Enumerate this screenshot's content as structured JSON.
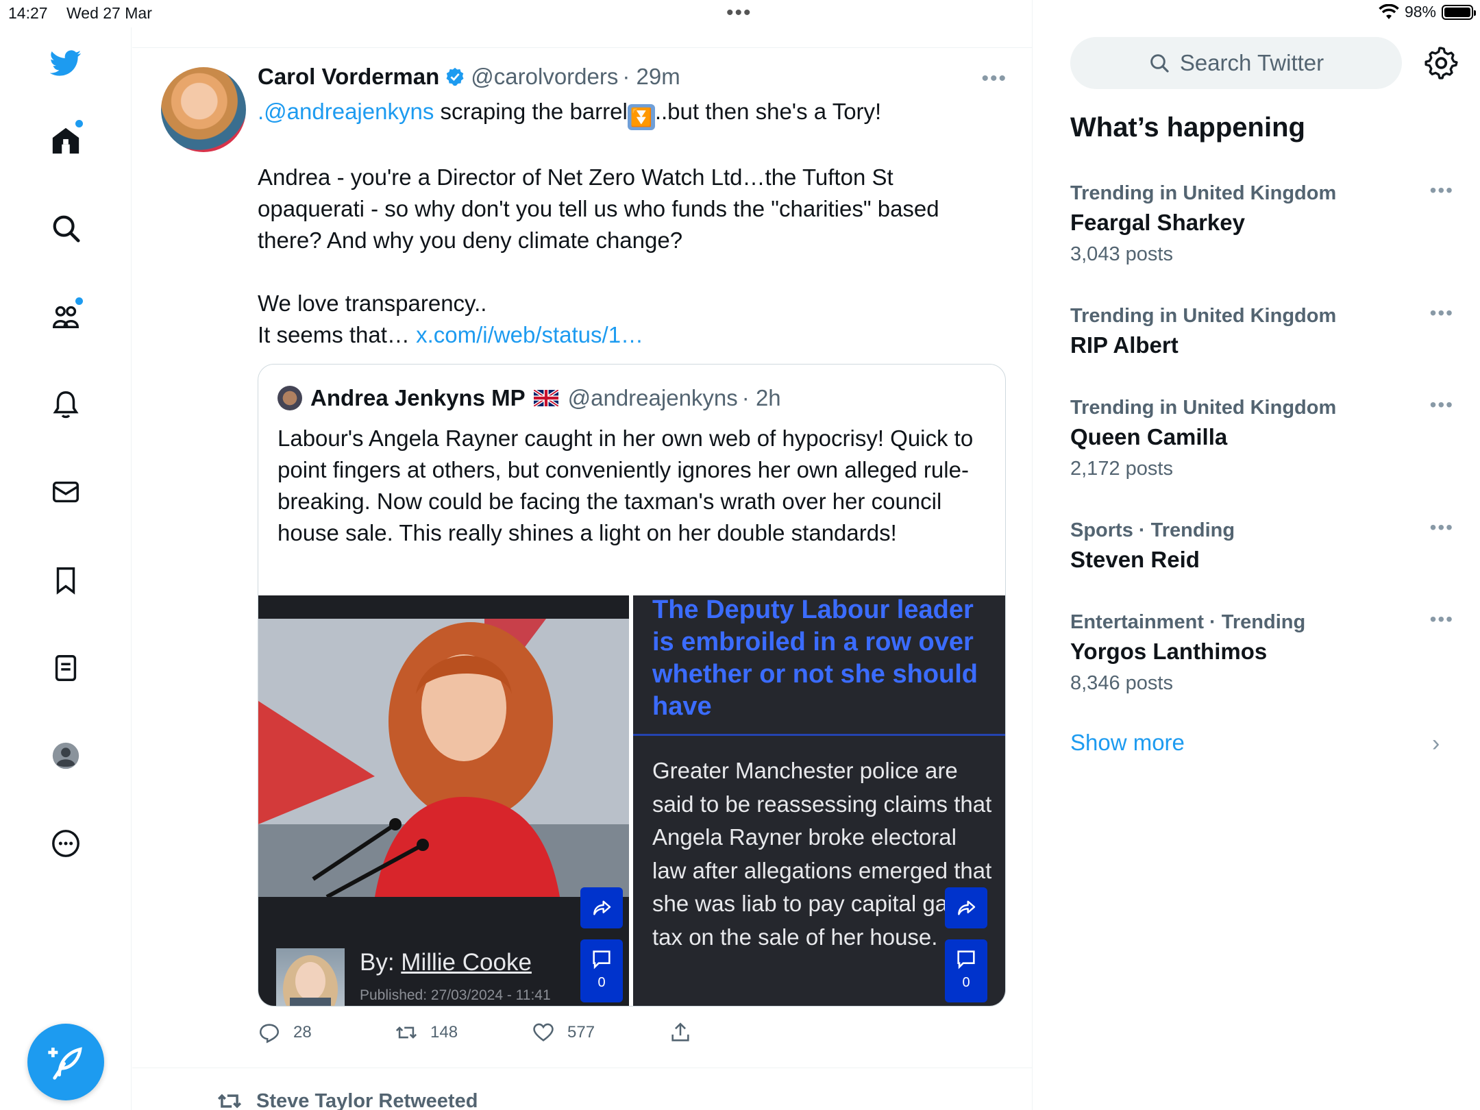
{
  "status_bar": {
    "time": "14:27",
    "date": "Wed 27 Mar",
    "battery": "98%"
  },
  "nav": {
    "items": [
      "home-icon",
      "search-icon",
      "communities-icon",
      "notifications-icon",
      "messages-icon",
      "bookmarks-icon",
      "lists-icon",
      "profile-icon",
      "more-icon"
    ],
    "accent": "#1d9bf0"
  },
  "tweet": {
    "author_name": "Carol Vorderman",
    "author_handle": "@carolvorders",
    "time": "· 29m",
    "line1_mention": ".@andreajenkyns",
    "line1_text": " scraping the barrel",
    "line1_emoji": "⏬",
    "line1_tail": "..but then she's a Tory!",
    "paragraph2": "Andrea - you're a Director of Net Zero Watch Ltd…the Tufton St opaquerati - so why don't you tell us who funds the \"charities\" based there? And why you deny climate change?",
    "line3": "We love transparency..",
    "line4_text": "It seems that… ",
    "line4_link": "x.com/i/web/status/1…",
    "replies": "28",
    "retweets": "148",
    "likes": "577"
  },
  "quote": {
    "author_name": "Andrea Jenkyns MP",
    "author_handle": "@andreajenkyns",
    "time": "· 2h",
    "text": "Labour's Angela Rayner caught in her own web of hypocrisy! Quick to point fingers at others, but conveniently ignores her own alleged rule-breaking. Now could be facing the taxman's wrath over her council house sale. This really shines a light on her double standards!",
    "media": {
      "byline_prefix": "By: ",
      "byline_author": "Millie Cooke",
      "published": "Published: 27/03/2024 - 11:41",
      "headline": "The Deputy Labour leader is embroiled in a row over whether or not she should have",
      "body": "Greater Manchester police are said to be reassessing claims that Angela Rayner broke electoral law after allegations emerged that she was liab to pay capital gains tax on the sale of her house.",
      "comment_count_left": "0",
      "comment_count_right": "0"
    }
  },
  "next_item": {
    "retweeted_by": "Steve Taylor Retweeted"
  },
  "sidebar": {
    "search_placeholder": "Search Twitter",
    "title": "What’s happening",
    "trends": [
      {
        "category": "Trending in United Kingdom",
        "name": "Feargal Sharkey",
        "count": "3,043 posts"
      },
      {
        "category": "Trending in United Kingdom",
        "name": "RIP Albert",
        "count": ""
      },
      {
        "category": "Trending in United Kingdom",
        "name": "Queen Camilla",
        "count": "2,172 posts"
      },
      {
        "category": "Sports · Trending",
        "name": "Steven Reid",
        "count": ""
      },
      {
        "category": "Entertainment · Trending",
        "name": "Yorgos Lanthimos",
        "count": "8,346 posts"
      }
    ],
    "show_more": "Show more"
  }
}
